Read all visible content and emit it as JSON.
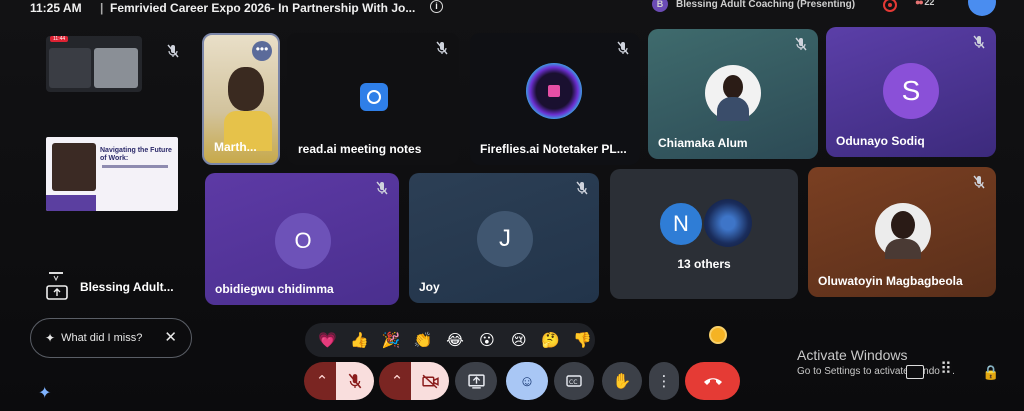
{
  "topbar": {
    "time": "11:25 AM",
    "separator": "|",
    "meeting_title": "Femrivied Career Expo 2026- In Partnership With Jo...",
    "presenter_initial": "B",
    "presenter_label": "Blessing Adult Coaching (Presenting)",
    "participant_count": "22"
  },
  "left_panel": {
    "recording_time": "11:44",
    "slide_heading": "Navigating the Future of Work:",
    "presentation_label": "Blessing Adult..."
  },
  "tiles": {
    "marth": {
      "name": "Marth..."
    },
    "readai": {
      "name": "read.ai meeting notes"
    },
    "fireflies": {
      "name": "Fireflies.ai Notetaker PL..."
    },
    "chiamaka": {
      "name": "Chiamaka Alum"
    },
    "odunayo": {
      "name": "Odunayo Sodiq",
      "initial": "S"
    },
    "obidiegwu": {
      "name": "obidiegwu chidimma",
      "initial": "O"
    },
    "joy": {
      "name": "Joy",
      "initial": "J"
    },
    "others": {
      "name": "13 others",
      "initial": "N"
    },
    "oluwatoyin": {
      "name": "Oluwatoyin Magbagbeola"
    }
  },
  "assistant": {
    "what_did_i_miss": "What did I miss?"
  },
  "reactions": [
    "💗",
    "👍",
    "🎉",
    "👏",
    "😂",
    "😮",
    "😢",
    "🤔",
    "👎"
  ],
  "windows_notice": {
    "line1": "Activate Windows",
    "line2": "Go to Settings to activate Windows."
  },
  "colors": {
    "accent_blue": "#4a8df0",
    "hangup_red": "#e53b35",
    "purple_tile": "#6a3fc2"
  }
}
